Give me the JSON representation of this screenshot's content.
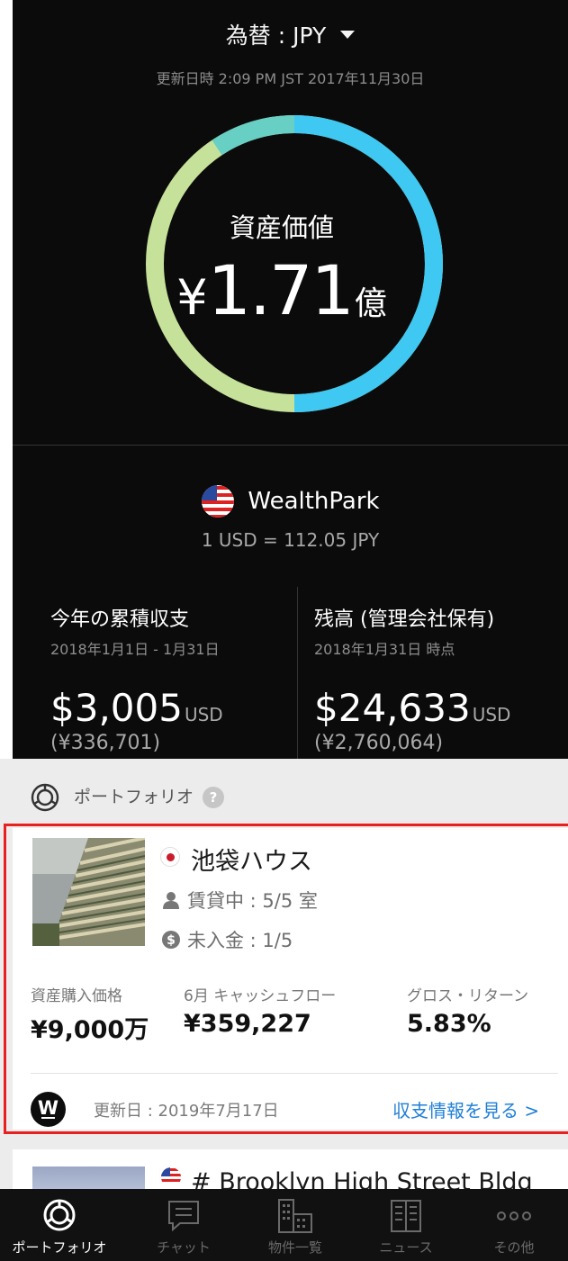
{
  "header": {
    "currency_label": "為替 : JPY",
    "updated": "更新日時 2:09 PM JST 2017年11月30日"
  },
  "asset_summary": {
    "label": "資産価値",
    "yen_symbol": "¥",
    "value": "1.71",
    "unit": "億",
    "ring_segments": [
      {
        "color": "#3fc8f2",
        "fraction": 0.5
      },
      {
        "color": "#c6e29a",
        "fraction": 0.35
      },
      {
        "color": "#67cfc4",
        "fraction": 0.15
      }
    ]
  },
  "manager": {
    "name": "WealthPark",
    "rate": "1 USD = 112.05 JPY"
  },
  "stats": {
    "ytd_title": "今年の累積収支",
    "ytd_period": "2018年1月1日 - 1月31日",
    "ytd_amount": "$3,005",
    "ytd_currency": "USD",
    "ytd_jpy": "(¥336,701)",
    "balance_title": "残高 (管理会社保有)",
    "balance_period": "2018年1月31日 時点",
    "balance_amount": "$24,633",
    "balance_currency": "USD",
    "balance_jpy": "(¥2,760,064)"
  },
  "portfolio": {
    "section_title": "ポートフォリオ",
    "help": "?"
  },
  "property": {
    "name": "池袋ハウス",
    "rental": "賃貸中 : 5/5 室",
    "unpaid": "未入金 : 1/5",
    "metric1_label": "資産購入価格",
    "metric1_value": "¥9,000万",
    "metric2_label": "6月 キャッシュフロー",
    "metric2_value": "¥359,227",
    "metric3_label": "グロス・リターン",
    "metric3_value": "5.83%",
    "pm_logo": "W",
    "updated": "更新日 : 2019年7月17日",
    "link": "収支情報を見る >"
  },
  "property2": {
    "name": "# Brooklyn High Street Bldg"
  },
  "tabs": [
    {
      "label": "ポートフォリオ",
      "icon": "portfolio-icon",
      "active": true
    },
    {
      "label": "チャット",
      "icon": "chat-icon",
      "active": false
    },
    {
      "label": "物件一覧",
      "icon": "building-icon",
      "active": false
    },
    {
      "label": "ニュース",
      "icon": "news-icon",
      "active": false
    },
    {
      "label": "その他",
      "icon": "more-icon",
      "active": false
    }
  ]
}
